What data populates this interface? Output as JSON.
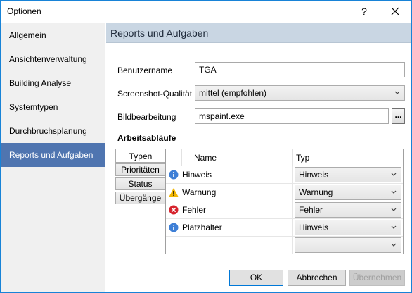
{
  "window": {
    "title": "Optionen",
    "help_label": "?"
  },
  "sidebar": {
    "items": [
      {
        "label": "Allgemein"
      },
      {
        "label": "Ansichtenverwaltung"
      },
      {
        "label": "Building Analyse"
      },
      {
        "label": "Systemtypen"
      },
      {
        "label": "Durchbruchsplanung"
      },
      {
        "label": "Reports und Aufgaben",
        "active": true
      }
    ]
  },
  "content": {
    "header": "Reports und Aufgaben",
    "username": {
      "label": "Benutzername",
      "value": "TGA"
    },
    "quality": {
      "label": "Screenshot-Qualität",
      "value": "mittel (empfohlen)"
    },
    "image_editor": {
      "label": "Bildbearbeitung",
      "value": "mspaint.exe",
      "browse_label": "..."
    },
    "workflows_title": "Arbeitsabläufe",
    "tabs": [
      {
        "label": "Typen",
        "active": true
      },
      {
        "label": "Prioritäten"
      },
      {
        "label": "Status"
      },
      {
        "label": "Übergänge"
      }
    ],
    "grid": {
      "columns": {
        "name": "Name",
        "type": "Typ"
      },
      "rows": [
        {
          "icon": "info-icon",
          "name": "Hinweis",
          "type": "Hinweis"
        },
        {
          "icon": "warning-icon",
          "name": "Warnung",
          "type": "Warnung"
        },
        {
          "icon": "error-icon",
          "name": "Fehler",
          "type": "Fehler"
        },
        {
          "icon": "info-icon",
          "name": "Platzhalter",
          "type": "Hinweis"
        },
        {
          "icon": "",
          "name": "",
          "type": ""
        }
      ]
    }
  },
  "buttons": {
    "ok": "OK",
    "cancel": "Abbrechen",
    "apply": "Übernehmen"
  },
  "colors": {
    "accent": "#4f75b0",
    "header_bg": "#c9d6e3",
    "info": "#3e7fd6",
    "warning": "#f2b705",
    "error": "#d6232d"
  }
}
